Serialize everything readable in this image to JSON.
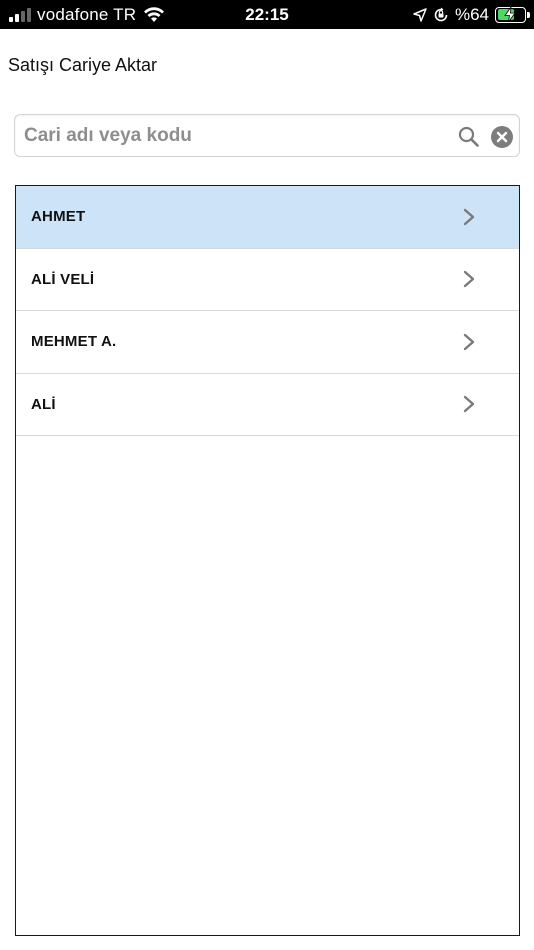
{
  "status_bar": {
    "carrier": "vodafone TR",
    "time": "22:15",
    "battery_percent": "%64",
    "battery_level": 0.64,
    "battery_color": "#4cd964"
  },
  "page": {
    "title": "Satışı Cariye Aktar"
  },
  "search": {
    "placeholder": "Cari adı veya kodu",
    "value": "",
    "search_icon": "search-icon",
    "clear_icon": "clear-icon"
  },
  "list": {
    "items": [
      {
        "label": "AHMET",
        "selected": true
      },
      {
        "label": "ALİ VELİ",
        "selected": false
      },
      {
        "label": "MEHMET A.",
        "selected": false
      },
      {
        "label": "ALİ",
        "selected": false
      }
    ],
    "selected_color": "#cde3f7"
  }
}
